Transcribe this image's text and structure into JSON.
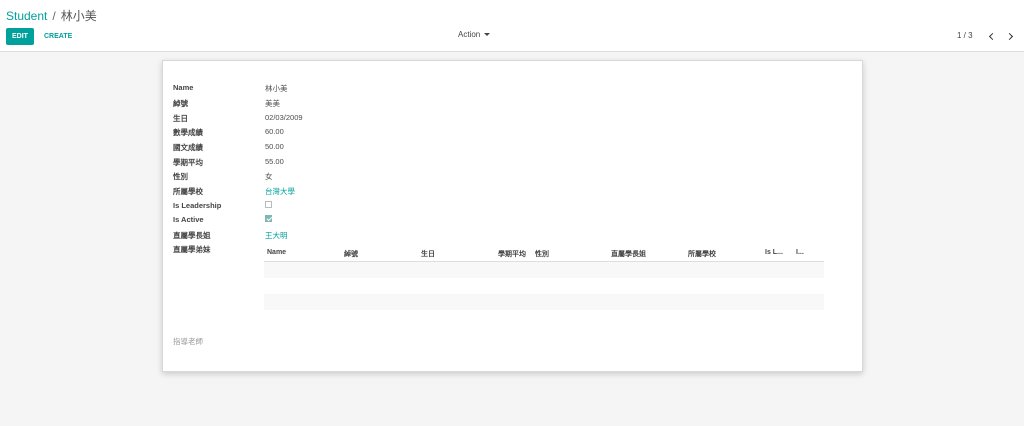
{
  "breadcrumb": {
    "parent": "Student",
    "separator": "/",
    "current": "林小美"
  },
  "toolbar": {
    "edit_label": "EDIT",
    "create_label": "CREATE",
    "action_label": "Action"
  },
  "pager": {
    "value": "1 / 3"
  },
  "colors": {
    "accent": "#00a09d",
    "background": "#f5f5f5",
    "sheet": "#ffffff"
  },
  "icons": {
    "pager_prev": "chevron-left-icon",
    "pager_next": "chevron-right-icon",
    "action_caret": "caret-down-icon"
  },
  "form": {
    "fields": [
      {
        "label": "Name",
        "value": "林小美"
      },
      {
        "label": "綽號",
        "value": "美美"
      },
      {
        "label": "生日",
        "value": "02/03/2009"
      },
      {
        "label": "數學成績",
        "value": "60.00"
      },
      {
        "label": "國文成績",
        "value": "50.00"
      },
      {
        "label": "學期平均",
        "value": "55.00"
      },
      {
        "label": "性別",
        "value": "女"
      },
      {
        "label": "所屬學校",
        "value": "台灣大學"
      },
      {
        "label": "Is Leadership",
        "checked": false
      },
      {
        "label": "Is Active",
        "checked": true
      },
      {
        "label": "直屬學長姐",
        "value": "王大明"
      },
      {
        "label": "直屬學弟妹"
      }
    ],
    "siblings_table": {
      "columns": [
        "Name",
        "綽號",
        "生日",
        "學期平均",
        "性別",
        "直屬學長姐",
        "所屬學校",
        "Is L...",
        "I..."
      ],
      "rows": []
    },
    "teacher_label": "指導老師"
  }
}
